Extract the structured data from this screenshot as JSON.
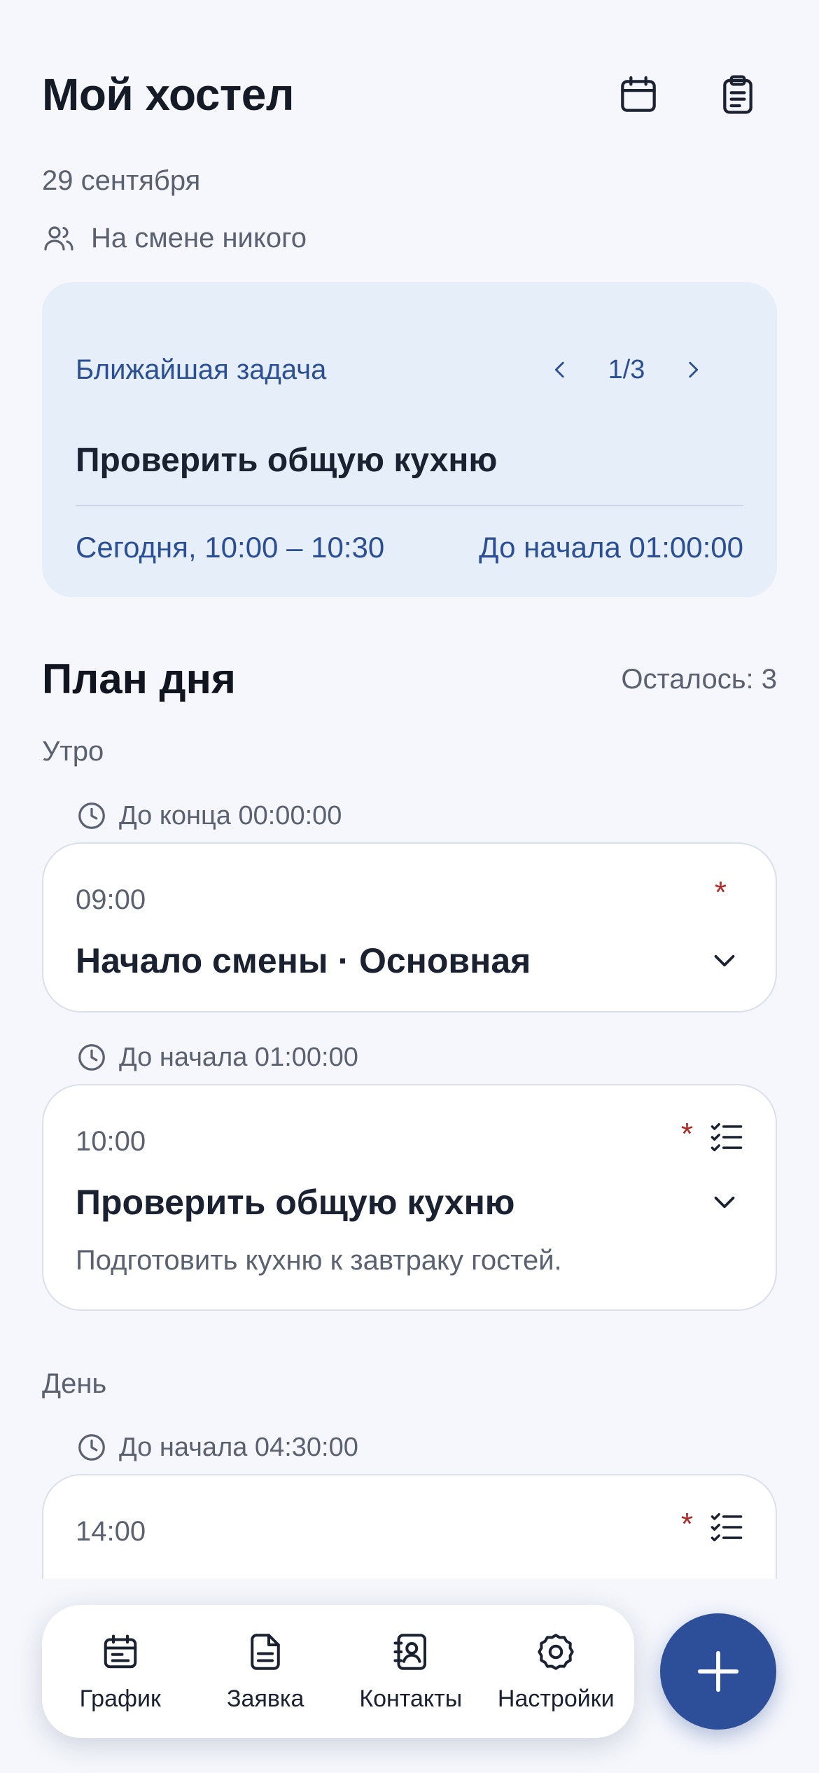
{
  "header": {
    "title": "Мой хостел",
    "calendar_icon": "calendar-icon",
    "clipboard_icon": "clipboard-icon"
  },
  "date": "29 сентября",
  "shift": {
    "icon": "users-icon",
    "text": "На смене никого"
  },
  "next_task": {
    "label": "Ближайшая задача",
    "counter": "1/3",
    "title": "Проверить общую кухню",
    "time": "Сегодня, 10:00 – 10:30",
    "countdown": "До начала 01:00:00"
  },
  "plan": {
    "title": "План дня",
    "remaining": "Осталось: 3",
    "sections": [
      {
        "label": "Утро",
        "tasks": [
          {
            "timer": "До конца 00:00:00",
            "time": "09:00",
            "required": "*",
            "title": "Начало смены · Основная",
            "has_checklist": false
          },
          {
            "timer": "До начала 01:00:00",
            "time": "10:00",
            "required": "*",
            "title": "Проверить общую кухню",
            "description": "Подготовить кухню к завтраку гостей.",
            "has_checklist": true
          }
        ]
      },
      {
        "label": "День",
        "tasks": [
          {
            "timer": "До начала 04:30:00",
            "time": "14:00",
            "required": "*",
            "has_checklist": true
          }
        ]
      }
    ]
  },
  "bottom_nav": [
    {
      "label": "График",
      "icon": "schedule-icon"
    },
    {
      "label": "Заявка",
      "icon": "document-icon"
    },
    {
      "label": "Контакты",
      "icon": "contacts-icon"
    },
    {
      "label": "Настройки",
      "icon": "settings-icon"
    }
  ],
  "fab": {
    "icon": "plus-icon"
  },
  "colors": {
    "background": "#f5f7fc",
    "accent": "#2d4e98",
    "card_highlight": "#e6eef9",
    "required": "#b02a2a"
  }
}
